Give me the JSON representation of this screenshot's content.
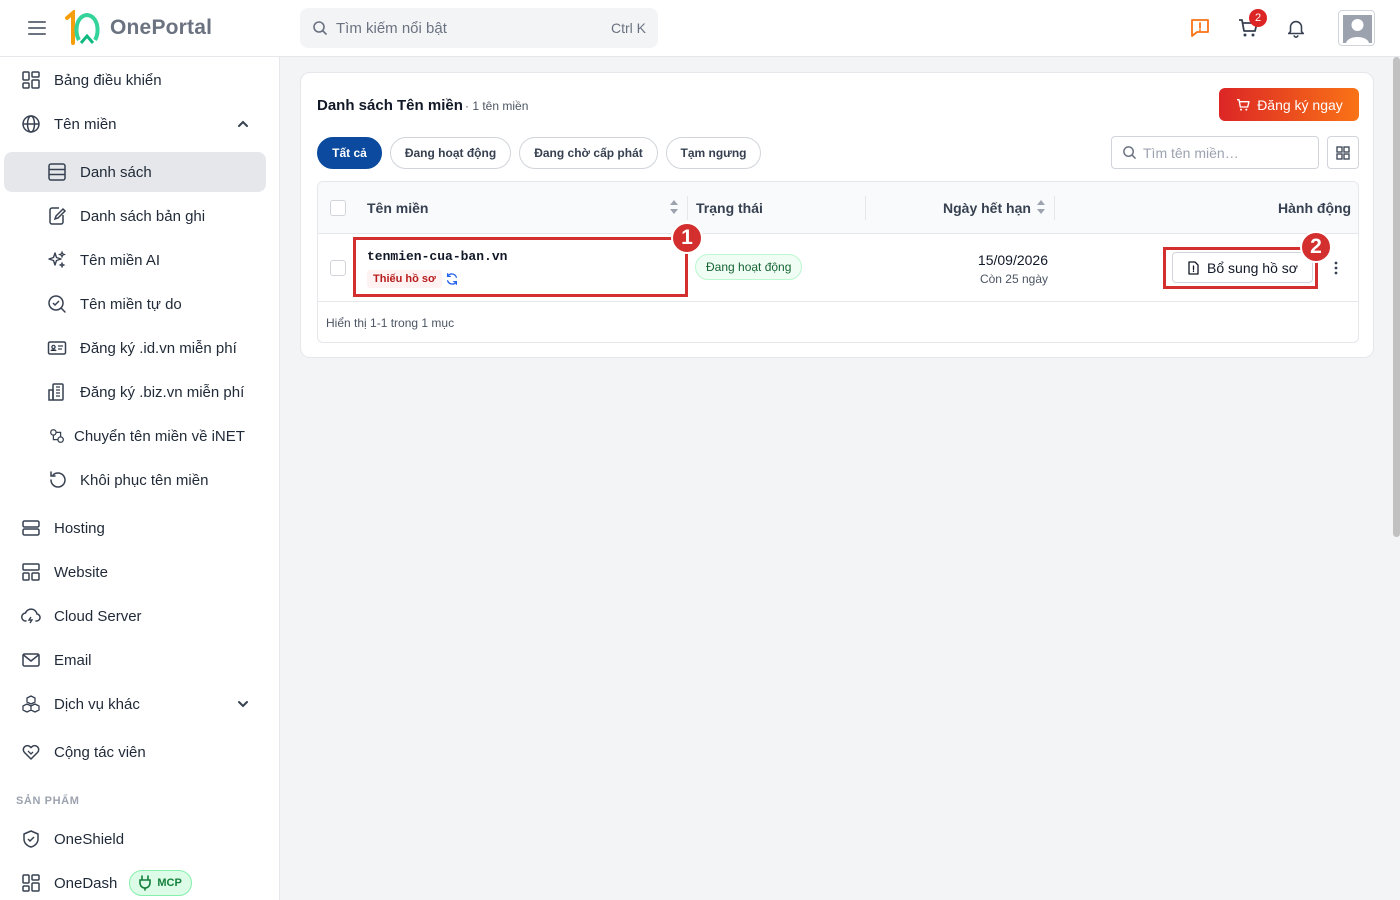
{
  "app": {
    "name": "OnePortal",
    "logo_mark": "1Ω"
  },
  "header": {
    "search_placeholder": "Tìm kiếm nổi bật",
    "search_shortcut": "Ctrl K",
    "cart_count": "2"
  },
  "sidebar": {
    "items": [
      {
        "label": "Bảng điều khiển",
        "icon": "dashboard-icon"
      },
      {
        "label": "Tên miền",
        "icon": "globe-icon"
      },
      {
        "label": "Danh sách",
        "icon": "list-icon"
      },
      {
        "label": "Danh sách bản ghi",
        "icon": "edit-doc-icon"
      },
      {
        "label": "Tên miền AI",
        "icon": "sparkle-icon"
      },
      {
        "label": "Tên miền tự do",
        "icon": "search-check-icon"
      },
      {
        "label": "Đăng ký .id.vn miễn phí",
        "icon": "id-card-icon"
      },
      {
        "label": "Đăng ký .biz.vn miễn phí",
        "icon": "building-icon"
      },
      {
        "label": "Chuyển tên miền về iNET",
        "icon": "transfer-icon"
      },
      {
        "label": "Khôi phục tên miền",
        "icon": "restore-icon"
      },
      {
        "label": "Hosting",
        "icon": "server-icon"
      },
      {
        "label": "Website",
        "icon": "website-icon"
      },
      {
        "label": "Cloud Server",
        "icon": "cloud-icon"
      },
      {
        "label": "Email",
        "icon": "mail-icon"
      },
      {
        "label": "Dịch vụ khác",
        "icon": "cubes-icon"
      },
      {
        "label": "Cộng tác viên",
        "icon": "handshake-icon"
      },
      {
        "label": "OneShield",
        "icon": "shield-icon"
      },
      {
        "label": "OneDash",
        "icon": "dashboard-icon"
      }
    ],
    "section_products": "SẢN PHẨM",
    "mcp_badge": "MCP"
  },
  "main": {
    "title": "Danh sách Tên miền",
    "count": "· 1 tên miền",
    "register_button": "Đăng ký ngay",
    "tabs": [
      "Tất cả",
      "Đang hoạt động",
      "Đang chờ cấp phát",
      "Tạm ngưng"
    ],
    "search_placeholder": "Tìm tên miền…",
    "columns": [
      "Tên miền",
      "Trạng thái",
      "Ngày hết hạn",
      "Hành động"
    ],
    "rows": [
      {
        "domain": "tenmien-cua-ban.vn",
        "flag": "Thiếu hồ sơ",
        "status": "Đang hoạt động",
        "expiry": "15/09/2026",
        "remaining": "Còn 25 ngày",
        "action": "Bổ sung hồ sơ"
      }
    ],
    "pager": "Hiển thị 1-1 trong 1 mục"
  },
  "annotations": [
    "1",
    "2"
  ],
  "colors": {
    "accent": "#0b4a9e",
    "danger": "#d32f2f",
    "brand_gradient_start": "#dc2626",
    "brand_gradient_end": "#f97316"
  }
}
